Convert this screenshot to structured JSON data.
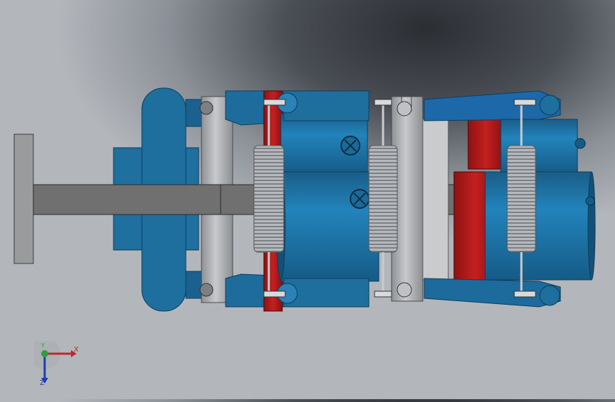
{
  "viewport": {
    "colors": {
      "part_blue": "#1f6f9f",
      "part_blue_dark": "#14527a",
      "part_red": "#b01818",
      "steel_gray": "#a9acb0",
      "shaft_gray": "#6f6f70",
      "spring_gray": "#8c8f93"
    },
    "parts": [
      "base-plate",
      "main-shaft",
      "cylinder-body",
      "tension-spring",
      "pivot-link",
      "connecting-arm",
      "guide-rail",
      "screw-head"
    ]
  },
  "triad": {
    "x_label": "X",
    "y_label": "Y",
    "z_label": "Z",
    "colors": {
      "x": "#c0262d",
      "y": "#2e9e3e",
      "z": "#1d3fa8"
    }
  }
}
